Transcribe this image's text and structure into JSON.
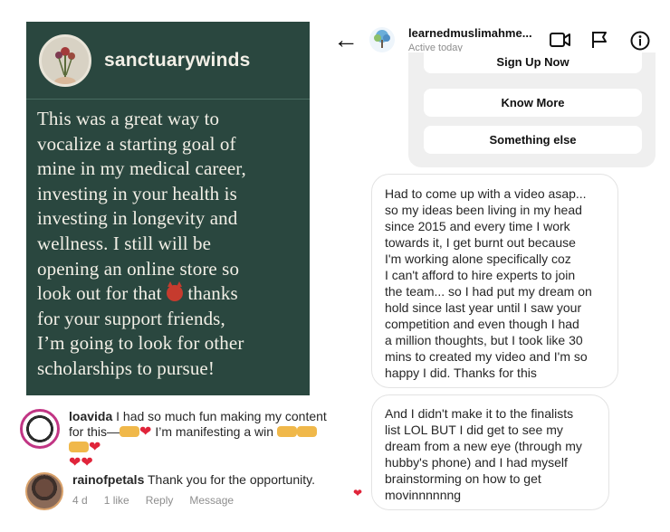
{
  "testimonial": {
    "handle": "sanctuarywinds",
    "lines": [
      "This was a great way to",
      "vocalize a starting goal of",
      "mine in my medical career,",
      "investing in your health is",
      "investing in longevity and",
      "wellness. I still will be",
      "opening an online store so",
      "look out for that",
      "thanks",
      "for your support friends,",
      "I’m going to look for other",
      "scholarships to pursue!"
    ]
  },
  "comments": [
    {
      "user": "loavida",
      "text_1": "I had so much fun making my content",
      "text_2": "for this—",
      "text_3": "I’m manifesting a win",
      "icon": "raising-hands-emoji"
    },
    {
      "user": "rainofpetals",
      "text": "Thank you for the opportunity.",
      "time": "4 d",
      "likes": "1 like",
      "reply": "Reply",
      "message": "Message"
    }
  ],
  "dm": {
    "name": "learnedmuslimahme...",
    "status": "Active today",
    "quick_replies": [
      "Sign Up Now",
      "Know More",
      "Something else"
    ],
    "message_1": [
      "Had to come up with a video asap...",
      "so my ideas been living in my head",
      "since 2015 and every time I work",
      "towards it, I get burnt out because",
      "I'm working alone specifically coz",
      "I can't afford to hire experts to join",
      "the team... so I had put my dream on",
      "hold since last year until I saw your",
      "competition and even though I had",
      "a million thoughts, but I took like 30",
      "mins to created my video and I'm so",
      "happy I did. Thanks for this"
    ],
    "message_2": [
      "And I didn't make it to the finalists",
      "list LOL BUT I did get to see my",
      "dream from a new eye (through my",
      "hubby's phone) and I had myself",
      "brainstorming on how to get",
      "movinnnnnng"
    ],
    "reaction": "heart"
  },
  "colors": {
    "card_bg": "#2a473f",
    "card_text": "#f2efe6",
    "heart": "#e0243a",
    "quick_reply_bg": "#efefef",
    "muted": "#8e8e8e"
  }
}
